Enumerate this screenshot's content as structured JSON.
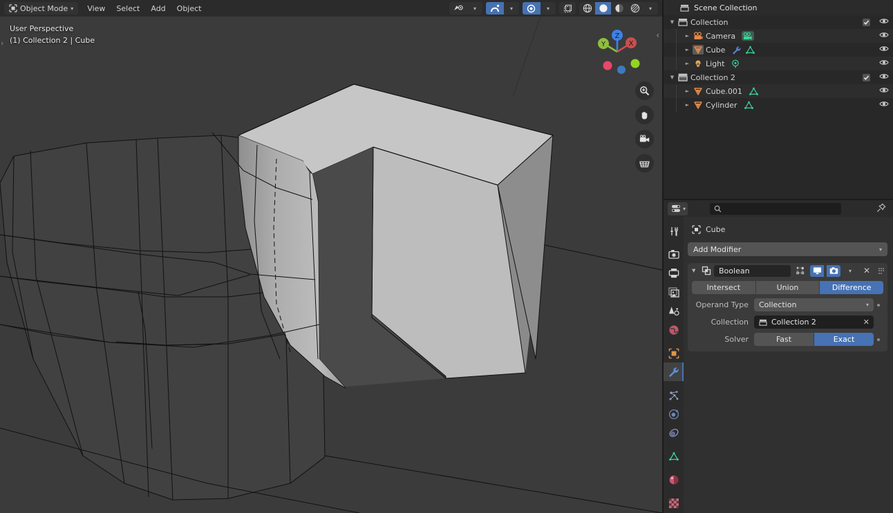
{
  "viewport": {
    "header": {
      "mode": "Object Mode",
      "mode_icon": "object-mode-icon",
      "menus": [
        "View",
        "Select",
        "Add",
        "Object"
      ],
      "visibility_icon": "visibility-eye-icon",
      "snap_icon": "snap-magnet-icon",
      "proportional_icon": "proportional-editing-icon",
      "xray_icon": "toggle-xray-icon",
      "shading_modes": [
        "wireframe",
        "solid",
        "material-preview",
        "rendered"
      ],
      "shading_active": "solid"
    },
    "overlay": {
      "perspective": "User Perspective",
      "scene_item": "(1) Collection 2 | Cube"
    },
    "gizmo": {
      "axes": [
        {
          "label": "Z",
          "color": "#3d82e8"
        },
        {
          "label": "Y",
          "color": "#8fbe3c"
        },
        {
          "label": "X",
          "color": "#e05a5a"
        }
      ],
      "neg_colors": [
        "#e8476a",
        "#3d7bbf",
        "#93d522"
      ]
    },
    "tools": [
      "zoom-icon",
      "pan-hand-icon",
      "camera-view-icon",
      "toggle-grid-icon"
    ],
    "background": "#3b3b3b"
  },
  "outliner": {
    "title": "Scene Collection",
    "title_icon": "scene-collection-icon",
    "rows": [
      {
        "label": "Collection",
        "icon": "collection-icon",
        "indent": 1,
        "disclosure": "open",
        "checkbox": true,
        "eye": true,
        "extras": []
      },
      {
        "label": "Camera",
        "icon": "camera-object-icon",
        "indent": 2,
        "disclosure": "closed",
        "checkbox": false,
        "eye": true,
        "extras": [
          "camera-data-icon"
        ]
      },
      {
        "label": "Cube",
        "icon": "mesh-object-icon-selected",
        "indent": 2,
        "disclosure": "closed",
        "checkbox": false,
        "eye": true,
        "extras": [
          "modifier-wrench-icon",
          "mesh-data-icon"
        ]
      },
      {
        "label": "Light",
        "icon": "light-object-icon",
        "indent": 2,
        "disclosure": "closed",
        "checkbox": false,
        "eye": true,
        "extras": [
          "light-data-icon"
        ]
      },
      {
        "label": "Collection 2",
        "icon": "collection-icon-active",
        "indent": 1,
        "disclosure": "open",
        "checkbox": true,
        "eye": true,
        "extras": []
      },
      {
        "label": "Cube.001",
        "icon": "mesh-object-icon",
        "indent": 2,
        "disclosure": "closed",
        "checkbox": false,
        "eye": true,
        "extras": [
          "mesh-data-icon"
        ]
      },
      {
        "label": "Cylinder",
        "icon": "mesh-object-icon",
        "indent": 2,
        "disclosure": "closed",
        "checkbox": false,
        "eye": true,
        "extras": [
          "mesh-data-icon"
        ]
      }
    ]
  },
  "properties": {
    "editor_icon": "editor-type-properties-icon",
    "search_placeholder": "",
    "search_value": "",
    "pin_icon": "pin-icon",
    "tabs": [
      {
        "name": "tool",
        "icon": "tool-icon",
        "active": false
      },
      {
        "name": "render",
        "icon": "render-icon",
        "active": false
      },
      {
        "name": "output",
        "icon": "output-printer-icon",
        "active": false
      },
      {
        "name": "view-layer",
        "icon": "view-layer-images-icon",
        "active": false
      },
      {
        "name": "scene",
        "icon": "scene-cone-icon",
        "active": false
      },
      {
        "name": "world",
        "icon": "world-globe-icon",
        "active": false
      },
      {
        "name": "object",
        "icon": "object-square-icon",
        "active": false
      },
      {
        "name": "modifiers",
        "icon": "wrench-icon",
        "active": true
      },
      {
        "name": "particles",
        "icon": "particles-icon",
        "active": false
      },
      {
        "name": "physics",
        "icon": "physics-orbit-icon",
        "active": false
      },
      {
        "name": "constraints",
        "icon": "constraints-icon",
        "active": false
      },
      {
        "name": "data",
        "icon": "mesh-data-green-icon",
        "active": false
      },
      {
        "name": "material",
        "icon": "material-sphere-icon",
        "active": false
      },
      {
        "name": "texture",
        "icon": "texture-checker-icon",
        "active": false
      }
    ],
    "breadcrumb": {
      "icon": "object-square-icon",
      "label": "Cube"
    },
    "add_modifier": "Add Modifier",
    "modifier": {
      "expand_icon": "disclosure-open-icon",
      "type_icon": "boolean-modifier-icon",
      "name": "Boolean",
      "toggles": [
        {
          "name": "edit-mode-display-toggle",
          "icon": "edit-mode-icon",
          "on": false
        },
        {
          "name": "realtime-display-toggle",
          "icon": "monitor-icon",
          "on": true
        },
        {
          "name": "render-display-toggle",
          "icon": "camera-icon",
          "on": true
        }
      ],
      "extras_icon": "chevron-down-icon",
      "close_icon": "close-x-icon",
      "drag_icon": "drag-grip-icon",
      "operations": [
        "Intersect",
        "Union",
        "Difference"
      ],
      "operation_active": "Difference",
      "fields": [
        {
          "label": "Operand Type",
          "value": "Collection",
          "kind": "dropdown",
          "animate_dot": true
        },
        {
          "label": "Collection",
          "value": "Collection 2",
          "kind": "id-ref",
          "icon": "collection-icon",
          "clearable": true,
          "animate_dot": false
        }
      ],
      "solver": {
        "label": "Solver",
        "options": [
          "Fast",
          "Exact"
        ],
        "active": "Exact",
        "animate_dot": true
      }
    }
  },
  "theme": {
    "accent": "#4772b3",
    "panel_bg": "#303030",
    "header_bg": "#2b2b2b",
    "outliner_bg": "#282828",
    "viewport_bg": "#3b3b3b",
    "field_bg": "#545454",
    "text": "#e5e5e5"
  }
}
